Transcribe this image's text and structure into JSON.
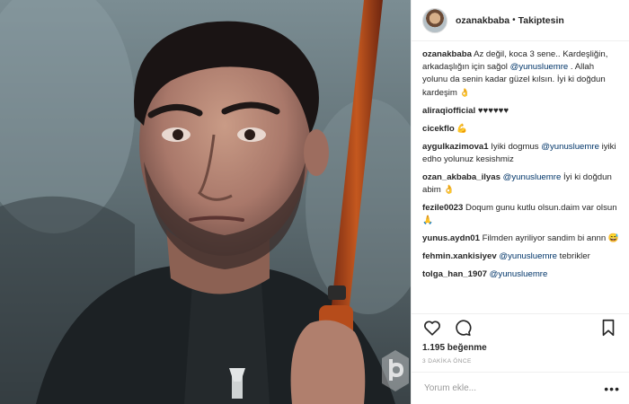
{
  "header": {
    "username": "ozanakbaba",
    "separator": "•",
    "follow_status": "Takiptesin"
  },
  "caption": {
    "username": "ozanakbaba",
    "text_before": "Az değil, koca 3 sene.. Kardeşliğin, arkadaşlığın için sağol ",
    "mention": "@yunusluemre",
    "text_after": " . Allah yolunu da senin kadar güzel kılsın. İyi ki doğdun kardeşim ",
    "emoji": "👌"
  },
  "comments": [
    {
      "username": "aliraqiofficial",
      "text": "♥♥♥♥♥♥",
      "mention": "",
      "after": ""
    },
    {
      "username": "cicekflo",
      "text": "💪",
      "mention": "",
      "after": ""
    },
    {
      "username": "aygulkazimova1",
      "text": "Iyiki dogmus ",
      "mention": "@yunusluemre",
      "after": " iyiki edho yolunuz kesishmiz"
    },
    {
      "username": "ozan_akbaba_ilyas",
      "text": "",
      "mention": "@yunusluemre",
      "after": " İyi ki doğdun abim 👌"
    },
    {
      "username": "fezile0023",
      "text": "Doqum gunu kutlu olsun.daim var olsun 🙏",
      "mention": "",
      "after": ""
    },
    {
      "username": "yunus.aydn01",
      "text": "Filmden ayriliyor sandim bi annn 😅",
      "mention": "",
      "after": ""
    },
    {
      "username": "fehmin.xankisiyev",
      "text": "",
      "mention": "@yunusluemre",
      "after": " tebrikler"
    },
    {
      "username": "tolga_han_1907",
      "text": "",
      "mention": "@yunusluemre",
      "after": ""
    }
  ],
  "likes": "1.195 beğenme",
  "timestamp": "3 DAKİKA ÖNCE",
  "comment_input": {
    "placeholder": "Yorum ekle..."
  },
  "more_label": "•••",
  "colors": {
    "mention": "#003569",
    "text": "#262626",
    "muted": "#999999"
  }
}
